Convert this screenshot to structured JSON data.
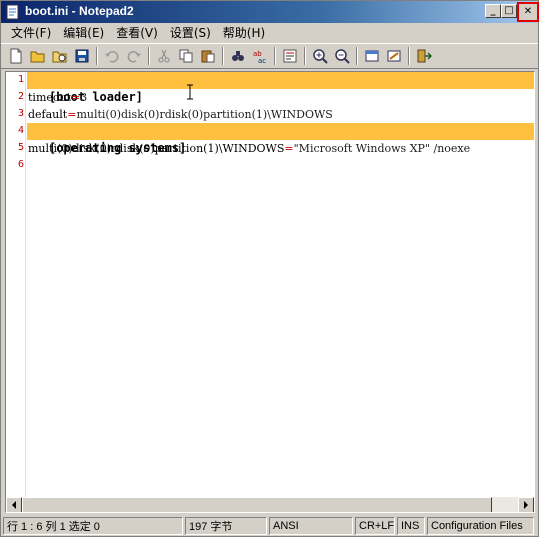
{
  "window": {
    "title": "boot.ini - Notepad2",
    "controls": {
      "minimize": "_",
      "maximize": "□",
      "close": "✕"
    }
  },
  "menu": [
    {
      "label": "文件(F)"
    },
    {
      "label": "编辑(E)"
    },
    {
      "label": "查看(V)"
    },
    {
      "label": "设置(S)"
    },
    {
      "label": "帮助(H)"
    }
  ],
  "toolbar": [
    {
      "name": "new-file-icon"
    },
    {
      "name": "open-folder-icon"
    },
    {
      "name": "browse-icon"
    },
    {
      "name": "save-icon"
    },
    {
      "sep": true
    },
    {
      "name": "undo-icon"
    },
    {
      "name": "redo-icon"
    },
    {
      "sep": true
    },
    {
      "name": "cut-icon"
    },
    {
      "name": "copy-icon"
    },
    {
      "name": "paste-icon"
    },
    {
      "sep": true
    },
    {
      "name": "find-icon"
    },
    {
      "name": "replace-icon"
    },
    {
      "sep": true
    },
    {
      "name": "word-wrap-icon"
    },
    {
      "sep": true
    },
    {
      "name": "zoom-in-icon"
    },
    {
      "name": "zoom-out-icon"
    },
    {
      "sep": true
    },
    {
      "name": "scheme-icon"
    },
    {
      "name": "customize-icon"
    },
    {
      "sep": true
    },
    {
      "name": "exit-icon"
    }
  ],
  "editor": {
    "line_numbers": [
      "1",
      "2",
      "3",
      "4",
      "5",
      "6"
    ],
    "lines": [
      {
        "text": "[boot loader]",
        "kind": "section",
        "highlight": true
      },
      {
        "key": "timeout",
        "eq": "=",
        "value": "3"
      },
      {
        "key": "default",
        "eq": "=",
        "value": "multi(0)disk(0)rdisk(0)partition(1)\\WINDOWS"
      },
      {
        "text": "[operating systems]",
        "kind": "section",
        "highlight": true
      },
      {
        "key": "multi(0)disk(0)rdisk(0)partition(1)\\WINDOWS",
        "eq": "=",
        "value": "\"Microsoft Windows XP\" /noexe"
      },
      {
        "text": ""
      }
    ]
  },
  "status": {
    "position": "行 1 : 6   列 1   选定 0",
    "size": "197 字节",
    "encoding": "ANSI",
    "line_endings": "CR+LF",
    "mode": "INS",
    "scheme": "Configuration Files"
  },
  "colors": {
    "highlight": "#ffc040",
    "line_number": "#c00000",
    "close_outline": "#e00000"
  }
}
